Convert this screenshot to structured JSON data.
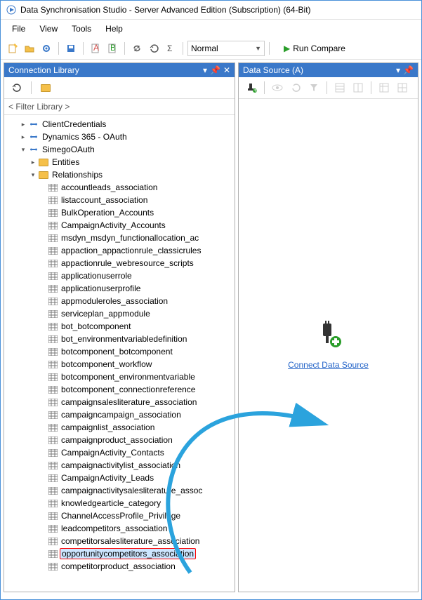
{
  "title": "Data Synchronisation Studio - Server Advanced Edition (Subscription) (64-Bit)",
  "menu": {
    "file": "File",
    "view": "View",
    "tools": "Tools",
    "help": "Help"
  },
  "toolbar": {
    "mode": "Normal",
    "run": "Run Compare"
  },
  "left": {
    "title": "Connection Library",
    "filter": "< Filter Library >",
    "nodes": {
      "client": "ClientCredentials",
      "dyn": "Dynamics 365 - OAuth",
      "simego": "SimegoOAuth",
      "entities": "Entities",
      "relationships": "Relationships"
    },
    "rels": [
      "accountleads_association",
      "listaccount_association",
      "BulkOperation_Accounts",
      "CampaignActivity_Accounts",
      "msdyn_msdyn_functionallocation_ac",
      "appaction_appactionrule_classicrules",
      "appactionrule_webresource_scripts",
      "applicationuserrole",
      "applicationuserprofile",
      "appmoduleroles_association",
      "serviceplan_appmodule",
      "bot_botcomponent",
      "bot_environmentvariabledefinition",
      "botcomponent_botcomponent",
      "botcomponent_workflow",
      "botcomponent_environmentvariable",
      "botcomponent_connectionreference",
      "campaignsalesliterature_association",
      "campaigncampaign_association",
      "campaignlist_association",
      "campaignproduct_association",
      "CampaignActivity_Contacts",
      "campaignactivitylist_association",
      "CampaignActivity_Leads",
      "campaignactivitysalesliterature_assoc",
      "knowledgearticle_category",
      "ChannelAccessProfile_Privilege",
      "leadcompetitors_association",
      "competitorsalesliterature_association",
      "opportunitycompetitors_association",
      "competitorproduct_association"
    ],
    "selectedIndex": 29
  },
  "right": {
    "title": "Data Source (A)",
    "connect": "Connect Data Source"
  }
}
